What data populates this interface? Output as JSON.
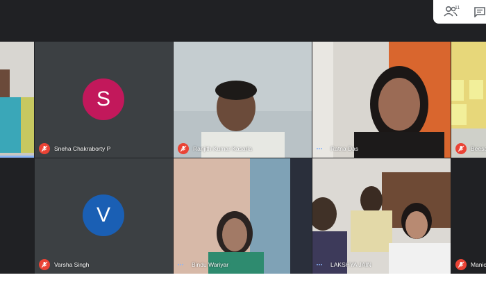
{
  "toolbar": {
    "participants_count": "11",
    "people_icon": "people-icon",
    "chat_icon": "chat-icon"
  },
  "colors": {
    "stage_bg": "#202124",
    "tile_bg": "#3c4043",
    "mute_red": "#ea4335",
    "avatar_s": "#c2185b",
    "avatar_v": "#1a5fb4"
  },
  "tiles": [
    {
      "name": "",
      "status": "none"
    },
    {
      "name": "Sneha Chakraborty P",
      "avatar_letter": "S",
      "status": "muted"
    },
    {
      "name": "Ranjith Kumar Kasarla",
      "status": "muted"
    },
    {
      "name": "Ratna Das",
      "status": "speaking"
    },
    {
      "name": "Beesa",
      "status": "muted"
    },
    {
      "name": "Varsha Singh",
      "avatar_letter": "V",
      "status": "muted"
    },
    {
      "name": "Bindu Wariyar",
      "status": "speaking"
    },
    {
      "name": "LAKSHYA JAIN",
      "status": "speaking"
    },
    {
      "name": "Manic",
      "status": "muted"
    }
  ]
}
